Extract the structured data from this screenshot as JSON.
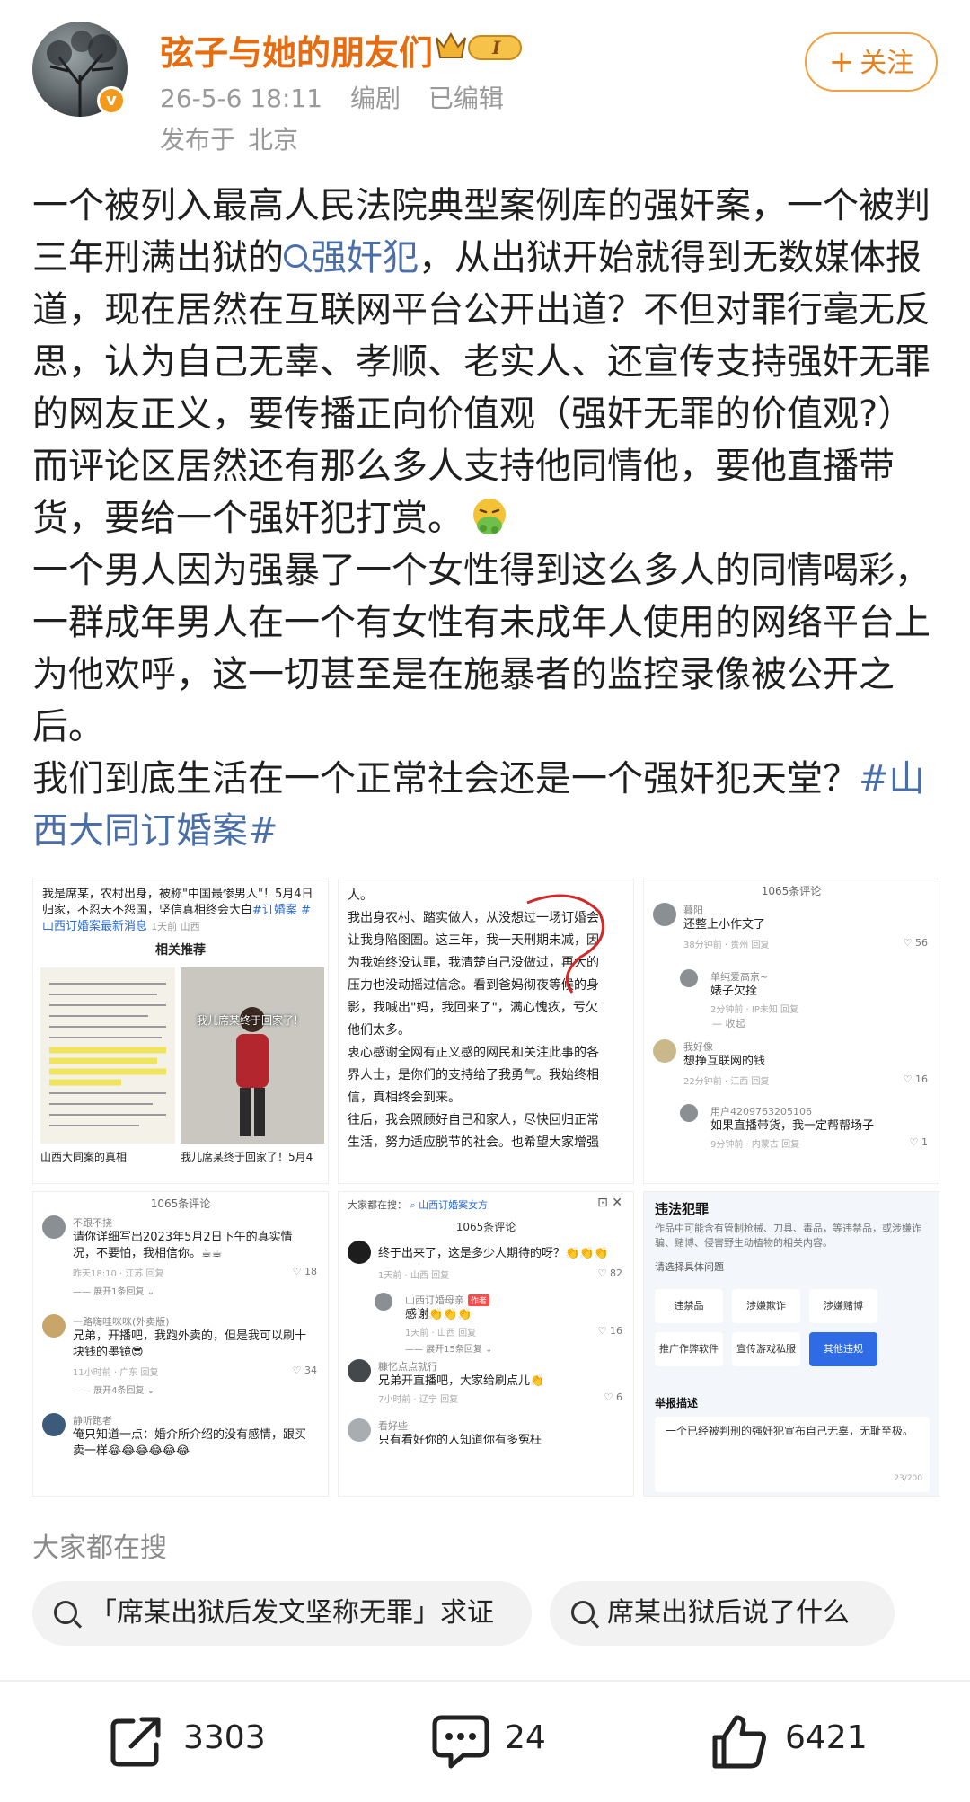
{
  "author": {
    "name": "弦子与她的朋友们",
    "rank_badge": "I",
    "verified_mark": "v",
    "date": "26-5-6 18:11",
    "edit": "编剧",
    "edited": "已编辑",
    "published_label": "发布于",
    "location": "北京",
    "follow_label": "关注"
  },
  "post": {
    "p1_part1": "一个被列入最高人民法院典型案例库的强奸案，一个被判三年刑满出狱的",
    "p1_link": "强奸犯",
    "p1_part2": "，从出狱开始就得到无数媒体报道，现在居然在互联网平台公开出道？不但对罪行毫无反思，认为自己无辜、孝顺、老实人、还宣传支持强奸无罪的网友正义，要传播正向价值观（强奸无罪的价值观?）而评论区居然还有那么多人支持他同情他，要他直播带货，要给一个强奸犯打赏。",
    "p2": "一个男人因为强暴了一个女性得到这么多人的同情喝彩，一群成年男人在一个有女性有未成年人使用的网络平台上为他欢呼，这一切甚至是在施暴者的监控录像被公开之后。",
    "p3_part1": "我们到底生活在一个正常社会还是一个强奸犯天堂？",
    "p3_tag": "#山西大同订婚案#"
  },
  "images": {
    "c1": {
      "header_a": "我是席某，农村出身，被称\"中国最惨男人\"！5月4日归家，不忍天不怨国，坚信真相终会大白",
      "header_tag": "#订婚案 #山西订婚案最新消息",
      "header_meta": "1天前 山西",
      "related": "相关推荐",
      "overlay": "我儿席某终于回家了!",
      "cap_left": "山西大同案的真相",
      "cap_right": "我儿席某终于回家了！5月4"
    },
    "c2": {
      "lines": [
        "人。",
        "我出身农村、踏实做人，从没想过一场订婚会",
        "让我身陷囹圄。这三年，我一天刑期未减，因",
        "为我始终没认罪，我清楚自己没做过，再大的",
        "压力也没动摇过信念。看到爸妈彻夜等候的身",
        "影，我喊出\"妈，我回来了\"，满心愧疚，亏欠",
        "他们太多。",
        "衷心感谢全网有正义感的网民和关注此事的各",
        "界人士，是你们的支持给了我勇气。我始终相",
        "信，真相终会到来。",
        "往后，我会照顾好自己和家人，尽快回归正常",
        "生活，努力适应脱节的社会。也希望大家增强"
      ]
    },
    "c3": {
      "count": "1065条评论",
      "comments": [
        {
          "name": "暮阳",
          "text": "还整上小作文了",
          "meta": "38分钟前 · 贵州  回复",
          "likes": "56"
        },
        {
          "name": "单纯爱高京~",
          "text": "婊子欠拴",
          "meta": "2分钟前 · IP未知  回复",
          "likes": ""
        },
        {
          "name": "我好像",
          "text": "想挣互联网的钱",
          "meta": "22分钟前 · 江西  回复",
          "likes": "16"
        },
        {
          "name": "用户4209763205106",
          "text": "如果直播带货，我一定帮帮场子",
          "meta": "9分钟前 · 内蒙古  回复",
          "likes": "1"
        }
      ],
      "collapse": "收起"
    },
    "c4": {
      "count": "1065条评论",
      "comments": [
        {
          "name": "不跟不挠",
          "text": "请你详细写出2023年5月2日下午的真实情况，不要怕，我相信你。☕☕",
          "meta": "昨天18:10 · 江苏  回复",
          "likes": "18",
          "expand": "展开1条回复"
        },
        {
          "name": "一路嗨哇咪咪(外卖版)",
          "text": "兄弟，开播吧，我跑外卖的，但是我可以刷十块钱的墨镜😎",
          "meta": "11小时前 · 广东  回复",
          "likes": "34",
          "expand": "展开4条回复"
        },
        {
          "name": "静听跑者",
          "text": "俺只知道一点：婚介所介绍的没有感情，跟买卖一样😂😂😂😂😂😂",
          "meta": "",
          "likes": "",
          "expand": ""
        }
      ]
    },
    "c5": {
      "search_prefix": "大家都在搜：",
      "search_term": "山西订婚案女方",
      "count": "1065条评论",
      "comments": [
        {
          "name": "",
          "text": "终于出来了，这是多少人期待的呀？👏👏👏",
          "meta": "1天前 · 山西  回复",
          "likes": "82"
        },
        {
          "name": "山西订婚母亲",
          "tag": "作者",
          "text": "感谢👏👏👏",
          "meta": "1天前 · 山西  回复",
          "likes": "16",
          "expand": "展开15条回复"
        },
        {
          "name": "糠忆点点就行",
          "text": "兄弟开直播吧，大家给刷点儿👏",
          "meta": "7小时前 · 辽宁  回复",
          "likes": "6"
        },
        {
          "name": "看好些",
          "text": "只有看好你的人知道你有多冤枉",
          "meta": "",
          "likes": ""
        }
      ]
    },
    "c6": {
      "title": "违法犯罪",
      "desc": "作品中可能含有管制枪械、刀具、毒品，等违禁品，或涉嫌诈骗、赌博、侵害野生动植物的相关内容。",
      "choose": "请选择具体问题",
      "options": [
        "违禁品",
        "涉嫌欺诈",
        "涉嫌赌博",
        "推广作弊软件",
        "宣传游戏私服",
        "其他违规"
      ],
      "active_option": "其他违规",
      "report_label": "举报描述",
      "report_text": "一个已经被判刑的强奸犯宣布自己无辜，无耻至极。",
      "report_count": "23/200"
    }
  },
  "hot_search": {
    "title": "大家都在搜",
    "items": [
      "「席某出狱后发文坚称无罪」求证",
      "席某出狱后说了什么"
    ]
  },
  "actions": {
    "share": "3303",
    "comment": "24",
    "like": "6421"
  },
  "colors": {
    "name": "#e86b0d",
    "link": "#4a6ea8",
    "follow": "#e8801a",
    "accent_blue": "#2f6be5"
  }
}
